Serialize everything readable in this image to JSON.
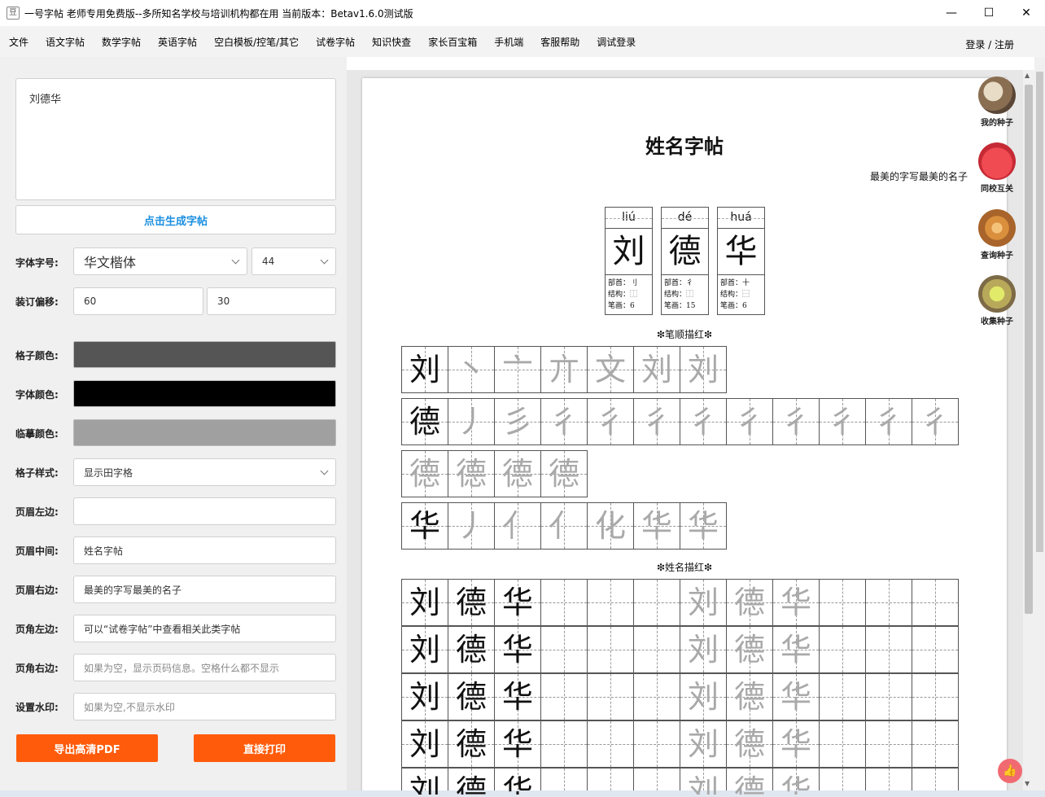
{
  "window": {
    "title": "一号字帖   老师专用免费版--多所知名学校与培训机构都在用 当前版本：Betav1.6.0测试版",
    "controls": [
      "—",
      "☐",
      "✕"
    ]
  },
  "menu": {
    "items": [
      "文件",
      "语文字帖",
      "数学字帖",
      "英语字帖",
      "空白模板/控笔/其它",
      "试卷字帖",
      "知识快查",
      "家长百宝箱",
      "手机端",
      "客服帮助",
      "调试登录"
    ],
    "login": "登录 / 注册"
  },
  "left": {
    "name_value": "刘德华",
    "generate_label": "点击生成字帖",
    "font_label": "字体字号:",
    "font_value": "华文楷体",
    "size_value": "44",
    "offset_label": "装订偏移:",
    "offset_x": "60",
    "offset_y": "30",
    "grid_color_label": "格子颜色:",
    "grid_color": "#555555",
    "font_color_label": "字体颜色:",
    "font_color": "#000000",
    "trace_color_label": "临摹颜色:",
    "trace_color": "#a0a0a0",
    "grid_style_label": "格子样式:",
    "grid_style_value": "显示田字格",
    "header_left_label": "页眉左边:",
    "header_left_value": "",
    "header_mid_label": "页眉中间:",
    "header_mid_value": "姓名字帖",
    "header_right_label": "页眉右边:",
    "header_right_value": "最美的字写最美的名子",
    "footer_left_label": "页角左边:",
    "footer_left_value": "可以“试卷字帖”中查看相关此类字帖",
    "footer_right_label": "页角右边:",
    "footer_right_placeholder": "如果为空，显示页码信息。空格什么都不显示",
    "watermark_label": "设置水印:",
    "watermark_placeholder": "如果为空,不显示水印",
    "export_label": "导出高清PDF",
    "print_label": "直接打印"
  },
  "page": {
    "title": "姓名字帖",
    "header_right": "最美的字写最美的名子",
    "stroke_section": "❇笔顺描红❇",
    "name_section": "❇姓名描红❇",
    "cards": [
      {
        "pinyin": "liú",
        "char": "刘",
        "radical": "部首：刂",
        "structure": "结构：⿰",
        "strokes": "笔画：6"
      },
      {
        "pinyin": "dé",
        "char": "德",
        "radical": "部首：彳",
        "structure": "结构：⿰",
        "strokes": "笔画：15"
      },
      {
        "pinyin": "huá",
        "char": "华",
        "radical": "部首：十",
        "structure": "结构：⿱",
        "strokes": "笔画：6"
      }
    ],
    "stroke_rows": [
      [
        "刘",
        "丶",
        "亠",
        "亣",
        "文",
        "刘",
        "刘"
      ],
      [
        "德",
        "丿",
        "彡",
        "彳",
        "彳",
        "彳",
        "彳",
        "彳",
        "彳",
        "彳",
        "彳",
        "彳"
      ],
      [
        "德",
        "德",
        "德",
        "德"
      ],
      [
        "华",
        "丿",
        "亻",
        "亻",
        "化",
        "华",
        "华"
      ]
    ],
    "name_chars": [
      "刘",
      "德",
      "华"
    ]
  },
  "side": {
    "items": [
      "我的种子",
      "同校互关",
      "查询种子",
      "收集种子"
    ]
  }
}
